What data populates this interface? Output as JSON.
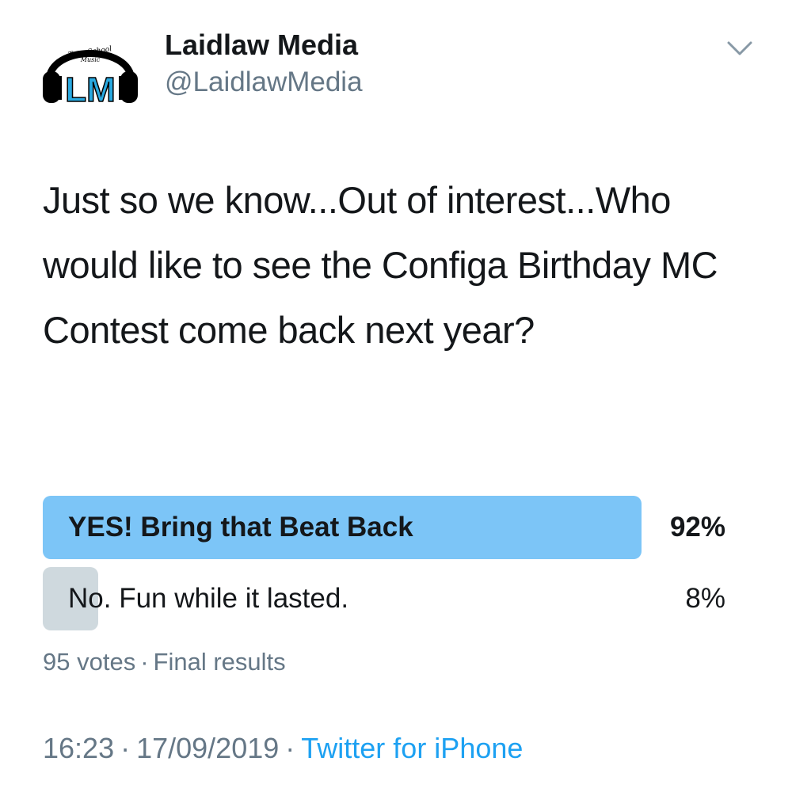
{
  "author": {
    "name": "Laidlaw Media",
    "handle": "@LaidlawMedia",
    "avatar_logo_text": "True-School Music",
    "avatar_initials": "LM"
  },
  "tweet": {
    "text": "Just so we know...Out of interest...Who would like to see the Configa Birthday MC Contest come back next year?"
  },
  "poll": {
    "options": [
      {
        "label": "YES! Bring that Beat Back",
        "percent": "92%",
        "value": 0.92,
        "winner": true
      },
      {
        "label": "No. Fun while it lasted.",
        "percent": "8%",
        "value": 0.08,
        "winner": false
      }
    ],
    "votes": "95 votes",
    "separator": "·",
    "status": "Final results"
  },
  "footer": {
    "time": "16:23",
    "date": "17/09/2019",
    "separator": "·",
    "source": "Twitter for iPhone"
  },
  "colors": {
    "winner_bar": "#7cc5f7",
    "loser_bar": "#cfd9de",
    "link": "#1da1f2",
    "secondary_text": "#657786",
    "avatar_blue": "#29a9e0"
  },
  "icons": {
    "caret": "chevron-down-icon",
    "avatar": "headphones-logo"
  }
}
